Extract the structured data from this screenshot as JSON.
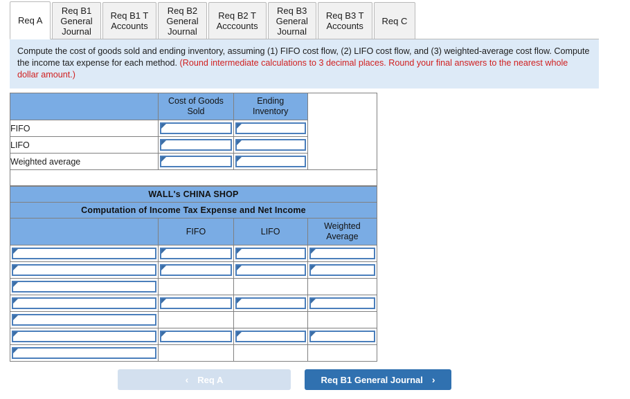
{
  "tabs": [
    {
      "label": "Req A",
      "active": true
    },
    {
      "label": "Req B1\nGeneral\nJournal",
      "active": false
    },
    {
      "label": "Req B1 T\nAccounts",
      "active": false
    },
    {
      "label": "Req B2\nGeneral\nJournal",
      "active": false
    },
    {
      "label": "Req B2 T\nAcccounts",
      "active": false
    },
    {
      "label": "Req B3\nGeneral\nJournal",
      "active": false
    },
    {
      "label": "Req B3 T\nAccounts",
      "active": false
    },
    {
      "label": "Req C",
      "active": false
    }
  ],
  "banner": {
    "text_main": "Compute the cost of goods sold and ending inventory, assuming (1) FIFO cost flow, (2) LIFO cost flow, and (3) weighted-average cost flow. Compute the income tax expense for each method. ",
    "text_warning": "(Round intermediate calculations to 3 decimal places. Round your final answers to the nearest whole dollar amount.)"
  },
  "table_one": {
    "headers": [
      "",
      "Cost of Goods\nSold",
      "Ending\nInventory",
      ""
    ],
    "rows": [
      {
        "label": "FIFO",
        "inputs": [
          true,
          true
        ]
      },
      {
        "label": "LIFO",
        "inputs": [
          true,
          true
        ]
      },
      {
        "label": "Weighted average",
        "inputs": [
          true,
          true
        ]
      }
    ]
  },
  "table_two": {
    "title": "WALL's CHINA SHOP",
    "subtitle": "Computation of Income Tax Expense and Net Income",
    "headers": [
      "",
      "FIFO",
      "LIFO",
      "Weighted\nAverage"
    ],
    "rows": [
      {
        "inputs": [
          true,
          true,
          true,
          true
        ]
      },
      {
        "inputs": [
          true,
          true,
          true,
          true
        ]
      },
      {
        "inputs": [
          true,
          false,
          false,
          false
        ]
      },
      {
        "inputs": [
          true,
          true,
          true,
          true
        ]
      },
      {
        "inputs": [
          true,
          false,
          false,
          false
        ]
      },
      {
        "inputs": [
          true,
          true,
          true,
          true
        ]
      },
      {
        "inputs": [
          true,
          false,
          false,
          false
        ]
      }
    ]
  },
  "footer": {
    "prev_label": "Req A",
    "prev_icon": "chevron-left-icon",
    "prev_glyph": "‹",
    "next_label": "Req B1 General Journal",
    "next_icon": "chevron-right-icon",
    "next_glyph": "›"
  },
  "colors": {
    "header_blue": "#7aace4",
    "banner_blue": "#ddeaf7",
    "button_blue": "#3071b0",
    "button_disabled": "#d3e0ef",
    "field_border": "#4a7ebb",
    "warning_red": "#d01f1f"
  }
}
